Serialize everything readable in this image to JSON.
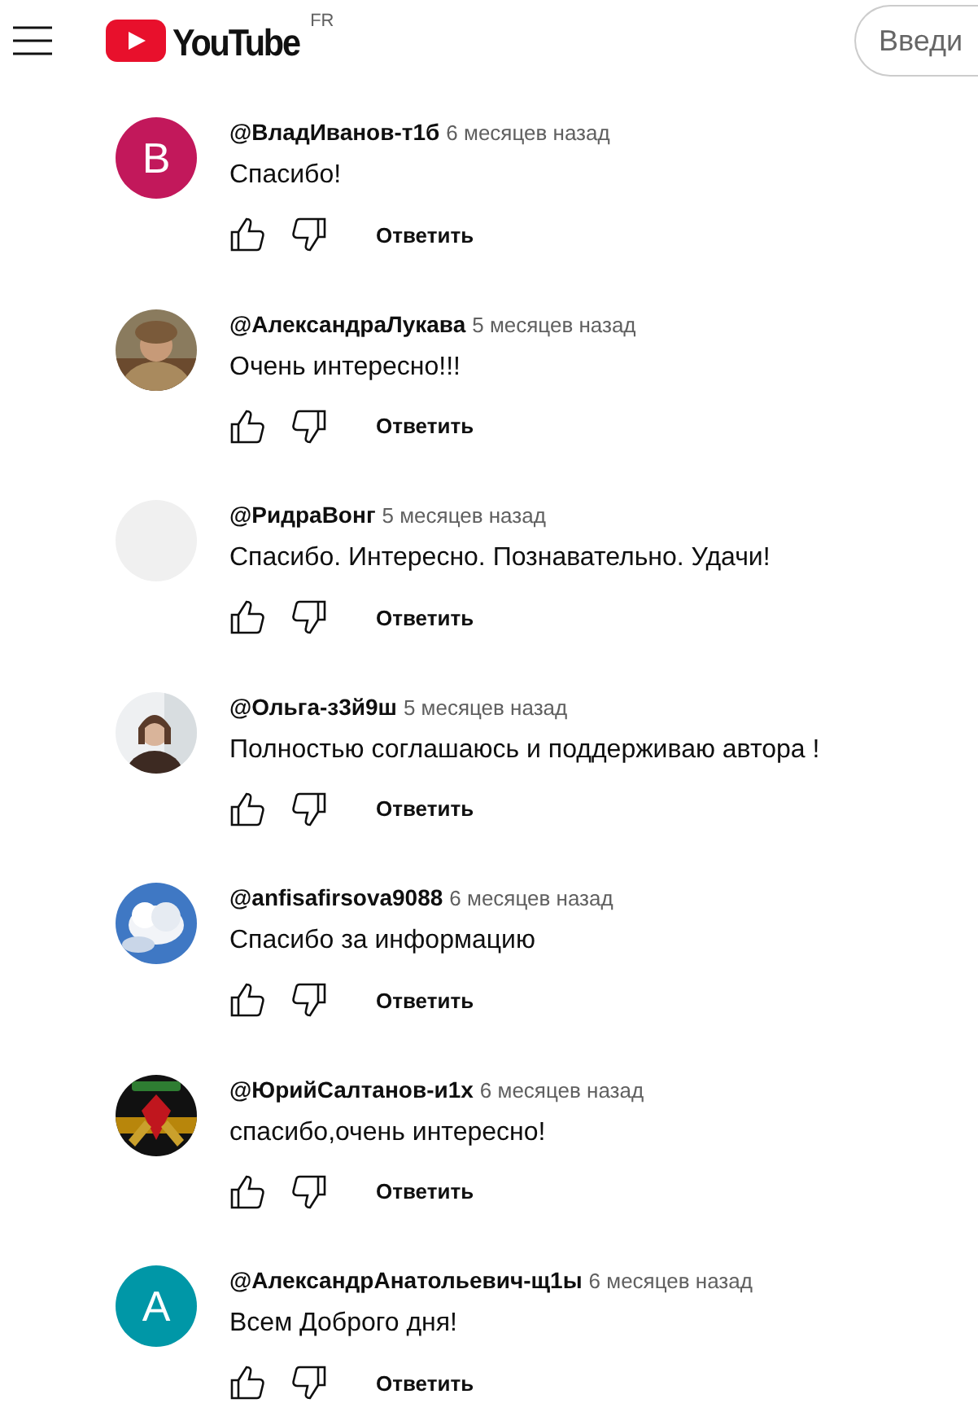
{
  "header": {
    "logo_text": "YouTube",
    "country_code": "FR",
    "search": {
      "placeholder": "Введи"
    }
  },
  "comments": [
    {
      "author": "@ВладИванов-т1б",
      "time": "6 месяцев назад",
      "text": "Спасибо!",
      "avatar": {
        "kind": "letter",
        "letter": "В",
        "color": "#c2185b"
      },
      "reply": "Ответить"
    },
    {
      "author": "@АлександраЛукава",
      "time": "5 месяцев назад",
      "text": "Очень интересно!!!",
      "reply": "Ответить"
    },
    {
      "author": "@РидраВонг",
      "time": "5 месяцев назад",
      "text": "Спасибо. Интересно. Познавательно. Удачи!",
      "avatar": {
        "kind": "empty"
      },
      "reply": "Ответить"
    },
    {
      "author": "@Ольга-з3й9ш",
      "time": "5 месяцев назад",
      "text": "Полностью соглашаюсь и поддерживаю автора !",
      "reply": "Ответить"
    },
    {
      "author": "@anfisafirsova9088",
      "time": "6 месяцев назад",
      "text": "Спасибо за информацию",
      "reply": "Ответить"
    },
    {
      "author": "@ЮрийСалтанов-и1х",
      "time": "6 месяцев назад",
      "text": "спасибо,очень интересно!",
      "reply": "Ответить"
    },
    {
      "author": "@АлександрАнатольевич-щ1ы",
      "time": "6 месяцев назад",
      "text": "Всем Доброго дня!",
      "avatar": {
        "kind": "letter",
        "letter": "А",
        "color": "#0097a7"
      },
      "reply": "Ответить"
    }
  ]
}
